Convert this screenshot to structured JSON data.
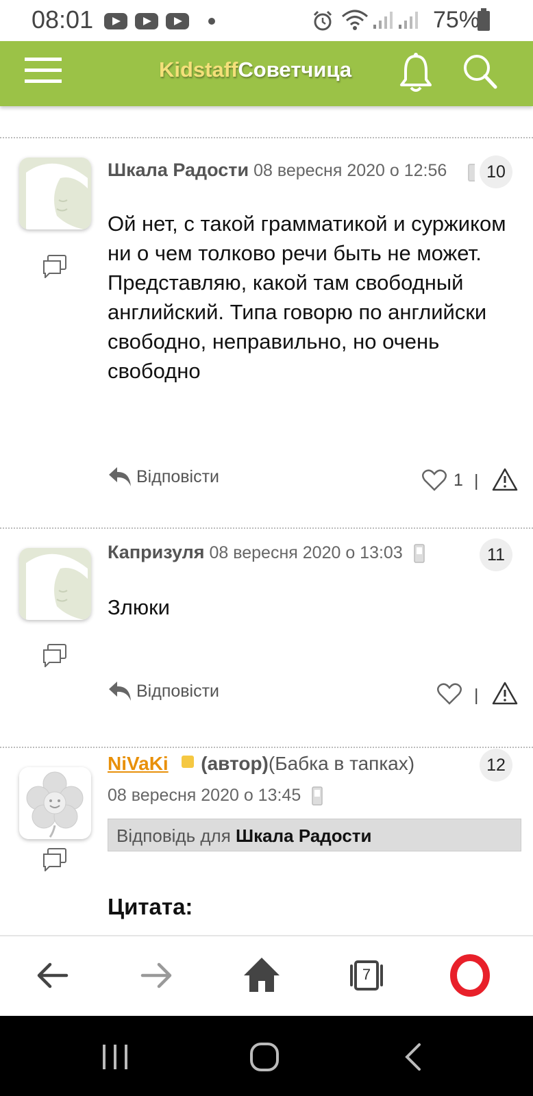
{
  "status_bar": {
    "time": "08:01",
    "battery": "75%"
  },
  "header": {
    "brand_part1": "Kidstaff",
    "brand_part2": "Советчица"
  },
  "posts": [
    {
      "author": "Шкала Радости",
      "date": "08 вересня 2020 о 12:56",
      "number": "10",
      "body": "Ой нет, с такой грамматикой и суржиком ни о чем толково речи быть не может. Представляю, какой там свободный английский. Типа говорю по английски свободно, неправильно, но очень свободно",
      "reply_label": "Відповісти",
      "likes": "1",
      "separator": "|"
    },
    {
      "author": "Капризуля",
      "date": "08 вересня 2020 о 13:03",
      "number": "11",
      "body": "Злюки",
      "reply_label": "Відповісти",
      "separator": "|"
    },
    {
      "author": "NiVaKi",
      "author_role": "(автор)",
      "author_status": "(Бабка в тапках)",
      "date": "08 вересня 2020 о 13:45",
      "number": "12",
      "reply_to_prefix": "Відповідь для",
      "reply_to_name": "Шкала Радости",
      "quote_label": "Цитата:"
    }
  ],
  "browser": {
    "tabs_count": "7"
  },
  "colors": {
    "header_green": "#9bc247",
    "author_orange": "#e8900a",
    "opera_red": "#e8202a"
  }
}
